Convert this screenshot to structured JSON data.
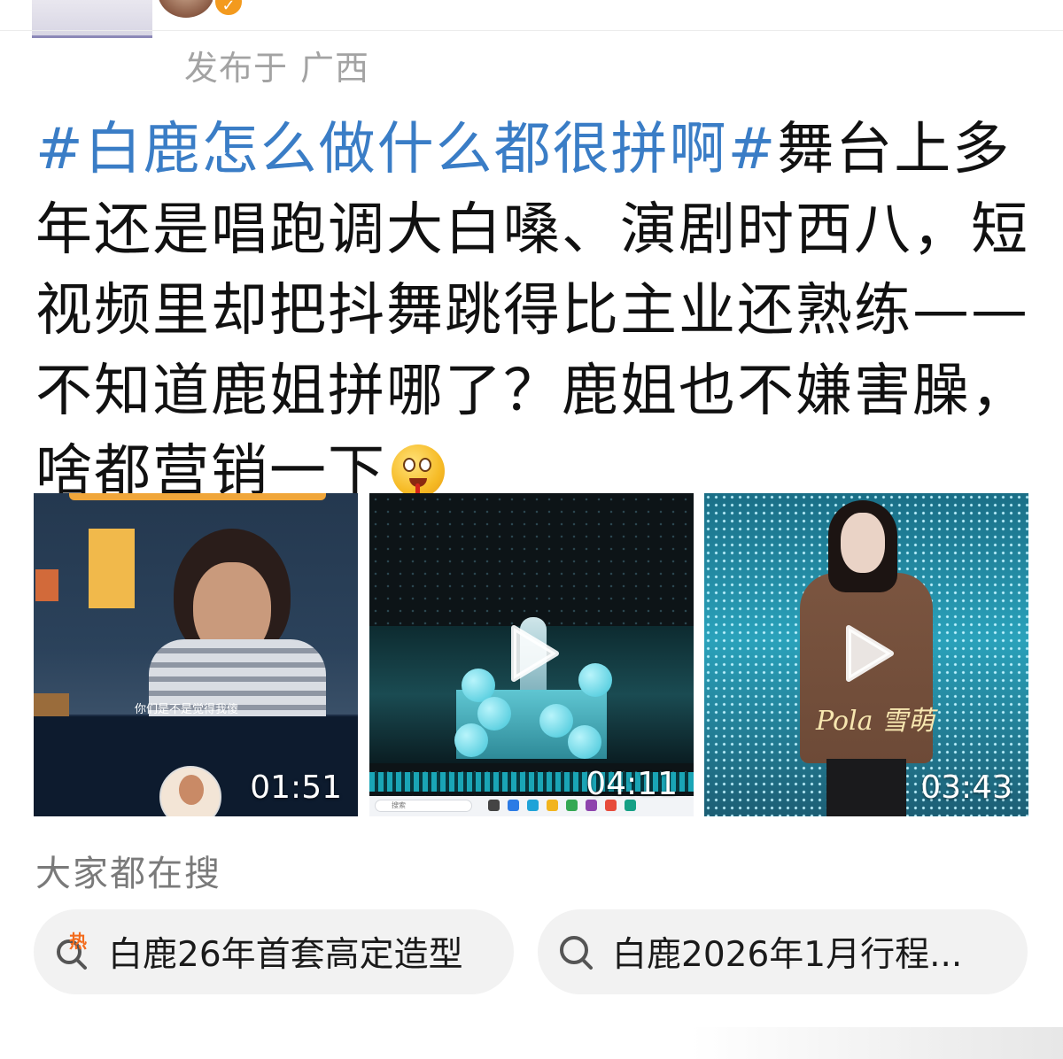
{
  "post": {
    "location_prefix": "发布于",
    "location": "广西",
    "hashtag": "#白鹿怎么做什么都很拼啊#",
    "body": "舞台上多年还是唱跑调大白嗓、演剧时西八，短视频里却把抖舞跳得比主业还熟练——不知道鹿姐拼哪了？鹿姐也不嫌害臊，啥都营销一下",
    "emoji": "drooling-face-emoji"
  },
  "videos": [
    {
      "duration": "01:51",
      "subtitle": "你们是不是觉得我傻"
    },
    {
      "duration": "04:11",
      "taskbar_search": "搜索"
    },
    {
      "duration": "03:43",
      "signature": "Pola 雪萌"
    }
  ],
  "search": {
    "title": "大家都在搜",
    "items": [
      {
        "label": "白鹿26年首套高定造型",
        "badge": "热",
        "icon": "hot-search-icon"
      },
      {
        "label": "白鹿2026年1月行程...",
        "icon": "search-icon"
      }
    ]
  },
  "colors": {
    "hashtag": "#3a7dc6",
    "body_text": "#111111",
    "muted": "#a3a3a3",
    "chip_bg": "#f2f2f2",
    "hot": "#f36b1c",
    "verified": "#f39a1e"
  }
}
